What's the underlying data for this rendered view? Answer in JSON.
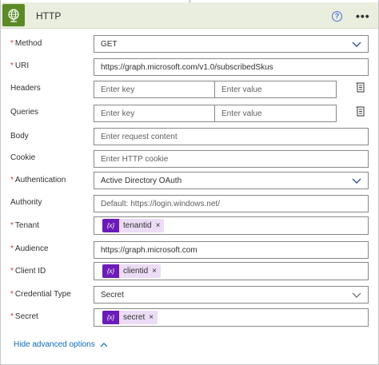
{
  "header": {
    "title": "HTTP",
    "help_glyph": "?",
    "more_glyph": "•••",
    "icons": {
      "app": "globe-icon",
      "help": "question-circle-icon",
      "more": "ellipsis-icon"
    },
    "colors": {
      "header_bg": "#e9eedf",
      "app_icon_bg": "#5c8a26",
      "accent": "#4b6fd4"
    }
  },
  "form": {
    "method": {
      "label": "Method",
      "required": "*",
      "value": "GET"
    },
    "uri": {
      "label": "URI",
      "required": "*",
      "value": "https://graph.microsoft.com/v1.0/subscribedSkus"
    },
    "headers": {
      "label": "Headers",
      "key_placeholder": "Enter key",
      "value_placeholder": "Enter value"
    },
    "queries": {
      "label": "Queries",
      "key_placeholder": "Enter key",
      "value_placeholder": "Enter value"
    },
    "body": {
      "label": "Body",
      "placeholder": "Enter request content"
    },
    "cookie": {
      "label": "Cookie",
      "placeholder": "Enter HTTP cookie"
    },
    "authentication": {
      "label": "Authentication",
      "required": "*",
      "value": "Active Directory OAuth"
    },
    "authority": {
      "label": "Authority",
      "placeholder": "Default: https://login.windows.net/"
    },
    "tenant": {
      "label": "Tenant",
      "required": "*",
      "token": "tenantid",
      "token_glyph": "{x}",
      "remove": "×"
    },
    "audience": {
      "label": "Audience",
      "required": "*",
      "value": "https://graph.microsoft.com"
    },
    "client_id": {
      "label": "Client ID",
      "required": "*",
      "token": "clientid",
      "token_glyph": "{x}",
      "remove": "×"
    },
    "credential_type": {
      "label": "Credential Type",
      "required": "*",
      "value": "Secret"
    },
    "secret": {
      "label": "Secret",
      "required": "*",
      "token": "secret",
      "token_glyph": "{x}",
      "remove": "×"
    }
  },
  "footer": {
    "advanced_label": "Hide advanced options"
  },
  "colors": {
    "required": "#d13438",
    "link": "#0b6aba",
    "token_bg": "#ecdcf6",
    "token_icon_bg": "#6b1bb8",
    "chevron_blue": "#2b579a"
  }
}
